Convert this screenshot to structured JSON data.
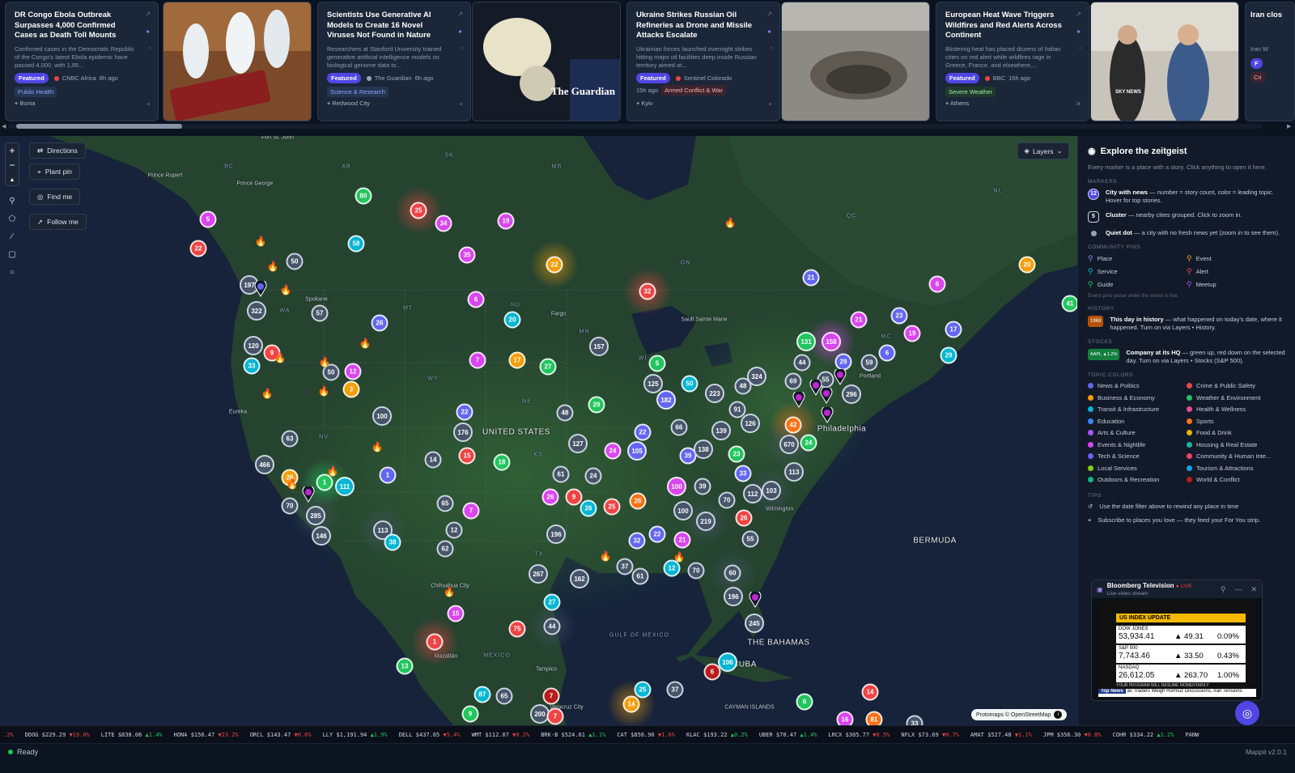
{
  "news": [
    {
      "title": "DR Congo Ebola Outbreak Surpasses 4,000 Confirmed Cases as Death Toll Mounts",
      "summary": "Confirmed cases in the Democratic Republic of the Congo's latest Ebola epidemic have passed 4,000, with 1,85...",
      "featured": "Featured",
      "source": "CNBC Africa",
      "time": "8h ago",
      "tag": "Public Health",
      "location": "Bunia"
    },
    {
      "title": "Scientists Use Generative AI Models to Create 16 Novel Viruses Not Found in Nature",
      "summary": "Researchers at Stanford University trained generative artificial intelligence models on biological genome data to...",
      "featured": "Featured",
      "source": "The Guardian",
      "time": "6h ago",
      "tag": "Science & Research",
      "location": "Redwood City"
    },
    {
      "title": "Ukraine Strikes Russian Oil Refineries as Drone and Missile Attacks Escalate",
      "summary": "Ukrainian forces launched overnight strikes hitting major oil facilities deep inside Russian territory aimed at...",
      "featured": "Featured",
      "source": "Sentinel Colorado",
      "time": "15h ago",
      "tag": "Armed Conflict & War",
      "location": "Kyiv"
    },
    {
      "title": "European Heat Wave Triggers Wildfires and Red Alerts Across Continent",
      "summary": "Blistering heat has placed dozens of Italian cities on red alert while wildfires rage in Greece, France, and elsewhere,...",
      "featured": "Featured",
      "source": "BBC",
      "time": "15h ago",
      "tag": "Severe Weather",
      "location": "Athens"
    }
  ],
  "partial_card": {
    "title": "Iran clos",
    "summary": "Iran W",
    "featured": "F",
    "tag": "Cri"
  },
  "image_labels": {
    "guardian": "The Guardian",
    "sky": "SKY NEWS"
  },
  "map": {
    "controls": {
      "zoom_in": "+",
      "zoom_out": "−",
      "compass": "▲",
      "directions": "Directions",
      "plant_pin": "Plant pin",
      "find_me": "Find me",
      "follow_me": "Follow me",
      "layers": "Layers"
    },
    "attribution": "Protomaps © OpenStreetMap",
    "labels": [
      {
        "t": "UNITED STATES",
        "k": "big"
      },
      {
        "t": "THE BAHAMAS",
        "k": "big"
      },
      {
        "t": "CUBA",
        "k": "big"
      },
      {
        "t": "BERMUDA",
        "k": "big"
      },
      {
        "t": "GULF OF MEXICO",
        "k": "st"
      },
      {
        "t": "CAYMAN ISLANDS",
        "k": "sm"
      },
      {
        "t": "Prince Rupert",
        "k": "sm"
      },
      {
        "t": "Prince George",
        "k": "sm"
      },
      {
        "t": "Fargo",
        "k": "sm"
      },
      {
        "t": "Sault Sainte Marie",
        "k": "sm"
      },
      {
        "t": "Spokane",
        "k": "sm"
      },
      {
        "t": "Eureka",
        "k": "sm"
      },
      {
        "t": "Wilmington",
        "k": "sm"
      },
      {
        "t": "Chihuahua City",
        "k": "sm"
      },
      {
        "t": "Mazatlán",
        "k": "sm"
      },
      {
        "t": "MEXICO",
        "k": "st"
      },
      {
        "t": "Tampico",
        "k": "sm"
      },
      {
        "t": "Veracruz City",
        "k": "sm"
      },
      {
        "t": "Philadelphia",
        "k": "big"
      },
      {
        "t": "Portland",
        "k": "sm"
      },
      {
        "t": "BC",
        "k": "st"
      },
      {
        "t": "AB",
        "k": "st"
      },
      {
        "t": "SK",
        "k": "st"
      },
      {
        "t": "MB",
        "k": "st"
      },
      {
        "t": "ON",
        "k": "st"
      },
      {
        "t": "QC",
        "k": "st"
      },
      {
        "t": "NL",
        "k": "st"
      },
      {
        "t": "WA",
        "k": "st"
      },
      {
        "t": "MT",
        "k": "st"
      },
      {
        "t": "ND",
        "k": "st"
      },
      {
        "t": "WY",
        "k": "st"
      },
      {
        "t": "NE",
        "k": "st"
      },
      {
        "t": "NV",
        "k": "st"
      },
      {
        "t": "KS",
        "k": "st"
      },
      {
        "t": "MN",
        "k": "st"
      },
      {
        "t": "WI",
        "k": "st"
      },
      {
        "t": "TX",
        "k": "st"
      },
      {
        "t": "MC",
        "k": "st"
      },
      {
        "t": "Fort St. John",
        "k": "sm"
      }
    ],
    "markers": [
      {
        "n": "80",
        "c": "#22c55e"
      },
      {
        "n": "25",
        "c": "#ef4444"
      },
      {
        "n": "34",
        "c": "#d946ef"
      },
      {
        "n": "19",
        "c": "#d946ef"
      },
      {
        "n": "5",
        "c": "#d946ef"
      },
      {
        "n": "22",
        "c": "#ef4444"
      },
      {
        "n": "58",
        "c": "#06b6d4"
      },
      {
        "n": "50",
        "c": "#475569"
      },
      {
        "n": "35",
        "c": "#d946ef"
      },
      {
        "n": "22",
        "c": "#f59e0b"
      },
      {
        "n": "20",
        "c": "#f59e0b"
      },
      {
        "n": "197",
        "c": "#475569"
      },
      {
        "n": "322",
        "c": "#475569"
      },
      {
        "n": "57",
        "c": "#475569"
      },
      {
        "n": "6",
        "c": "#d946ef"
      },
      {
        "n": "32",
        "c": "#ef4444"
      },
      {
        "n": "21",
        "c": "#6366f1"
      },
      {
        "n": "6",
        "c": "#d946ef"
      },
      {
        "n": "41",
        "c": "#22c55e"
      },
      {
        "n": "20",
        "c": "#06b6d4"
      },
      {
        "n": "26",
        "c": "#6366f1"
      },
      {
        "n": "120",
        "c": "#475569"
      },
      {
        "n": "9",
        "c": "#ef4444"
      },
      {
        "n": "33",
        "c": "#06b6d4"
      },
      {
        "n": "157",
        "c": "#475569"
      },
      {
        "n": "21",
        "c": "#d946ef"
      },
      {
        "n": "23",
        "c": "#6366f1"
      },
      {
        "n": "17",
        "c": "#6366f1"
      },
      {
        "n": "19",
        "c": "#d946ef"
      },
      {
        "n": "7",
        "c": "#d946ef"
      },
      {
        "n": "17",
        "c": "#f59e0b"
      },
      {
        "n": "27",
        "c": "#22c55e"
      },
      {
        "n": "50",
        "c": "#475569"
      },
      {
        "n": "12",
        "c": "#d946ef"
      },
      {
        "n": "3",
        "c": "#f59e0b"
      },
      {
        "n": "5",
        "c": "#22c55e"
      },
      {
        "n": "131",
        "c": "#22c55e"
      },
      {
        "n": "158",
        "c": "#d946ef"
      },
      {
        "n": "29",
        "c": "#6366f1"
      },
      {
        "n": "59",
        "c": "#475569"
      },
      {
        "n": "6",
        "c": "#6366f1"
      },
      {
        "n": "29",
        "c": "#06b6d4"
      },
      {
        "n": "125",
        "c": "#475569"
      },
      {
        "n": "50",
        "c": "#06b6d4"
      },
      {
        "n": "44",
        "c": "#475569"
      },
      {
        "n": "324",
        "c": "#475569"
      },
      {
        "n": "69",
        "c": "#475569"
      },
      {
        "n": "55",
        "c": "#475569"
      },
      {
        "n": "296",
        "c": "#475569"
      },
      {
        "n": "223",
        "c": "#475569"
      },
      {
        "n": "48",
        "c": "#475569"
      },
      {
        "n": "182",
        "c": "#6366f1"
      },
      {
        "n": "100",
        "c": "#475569"
      },
      {
        "n": "48",
        "c": "#475569"
      },
      {
        "n": "29",
        "c": "#22c55e"
      },
      {
        "n": "91",
        "c": "#475569"
      },
      {
        "n": "22",
        "c": "#6366f1"
      },
      {
        "n": "176",
        "c": "#475569"
      },
      {
        "n": "126",
        "c": "#475569"
      },
      {
        "n": "42",
        "c": "#f97316"
      },
      {
        "n": "670",
        "c": "#475569"
      },
      {
        "n": "24",
        "c": "#22c55e"
      },
      {
        "n": "63",
        "c": "#475569"
      },
      {
        "n": "127",
        "c": "#475569"
      },
      {
        "n": "24",
        "c": "#d946ef"
      },
      {
        "n": "105",
        "c": "#6366f1"
      },
      {
        "n": "66",
        "c": "#475569"
      },
      {
        "n": "139",
        "c": "#475569"
      },
      {
        "n": "22",
        "c": "#6366f1"
      },
      {
        "n": "14",
        "c": "#475569"
      },
      {
        "n": "15",
        "c": "#ef4444"
      },
      {
        "n": "18",
        "c": "#22c55e"
      },
      {
        "n": "39",
        "c": "#6366f1"
      },
      {
        "n": "138",
        "c": "#475569"
      },
      {
        "n": "23",
        "c": "#22c55e"
      },
      {
        "n": "113",
        "c": "#475569"
      },
      {
        "n": "466",
        "c": "#475569"
      },
      {
        "n": "26",
        "c": "#f59e0b"
      },
      {
        "n": "1",
        "c": "#22c55e"
      },
      {
        "n": "111",
        "c": "#06b6d4"
      },
      {
        "n": "1",
        "c": "#6366f1"
      },
      {
        "n": "61",
        "c": "#475569"
      },
      {
        "n": "24",
        "c": "#475569"
      },
      {
        "n": "33",
        "c": "#6366f1"
      },
      {
        "n": "103",
        "c": "#475569"
      },
      {
        "n": "70",
        "c": "#475569"
      },
      {
        "n": "285",
        "c": "#475569"
      },
      {
        "n": "65",
        "c": "#475569"
      },
      {
        "n": "7",
        "c": "#d946ef"
      },
      {
        "n": "26",
        "c": "#d946ef"
      },
      {
        "n": "9",
        "c": "#ef4444"
      },
      {
        "n": "26",
        "c": "#06b6d4"
      },
      {
        "n": "25",
        "c": "#ef4444"
      },
      {
        "n": "26",
        "c": "#f97316"
      },
      {
        "n": "100",
        "c": "#d946ef"
      },
      {
        "n": "39",
        "c": "#475569"
      },
      {
        "n": "70",
        "c": "#475569"
      },
      {
        "n": "112",
        "c": "#475569"
      },
      {
        "n": "146",
        "c": "#475569"
      },
      {
        "n": "113",
        "c": "#475569"
      },
      {
        "n": "38",
        "c": "#06b6d4"
      },
      {
        "n": "12",
        "c": "#475569"
      },
      {
        "n": "62",
        "c": "#475569"
      },
      {
        "n": "196",
        "c": "#475569"
      },
      {
        "n": "100",
        "c": "#475569"
      },
      {
        "n": "219",
        "c": "#475569"
      },
      {
        "n": "26",
        "c": "#ef4444"
      },
      {
        "n": "32",
        "c": "#6366f1"
      },
      {
        "n": "22",
        "c": "#6366f1"
      },
      {
        "n": "21",
        "c": "#d946ef"
      },
      {
        "n": "55",
        "c": "#475569"
      },
      {
        "n": "267",
        "c": "#475569"
      },
      {
        "n": "162",
        "c": "#475569"
      },
      {
        "n": "37",
        "c": "#475569"
      },
      {
        "n": "61",
        "c": "#475569"
      },
      {
        "n": "12",
        "c": "#06b6d4"
      },
      {
        "n": "70",
        "c": "#475569"
      },
      {
        "n": "60",
        "c": "#475569"
      },
      {
        "n": "196",
        "c": "#475569"
      },
      {
        "n": "245",
        "c": "#475569"
      },
      {
        "n": "27",
        "c": "#06b6d4"
      },
      {
        "n": "44",
        "c": "#475569"
      },
      {
        "n": "15",
        "c": "#d946ef"
      },
      {
        "n": "75",
        "c": "#ef4444"
      },
      {
        "n": "1",
        "c": "#ef4444"
      },
      {
        "n": "13",
        "c": "#22c55e"
      },
      {
        "n": "106",
        "c": "#06b6d4"
      },
      {
        "n": "6",
        "c": "#b91c1c"
      },
      {
        "n": "87",
        "c": "#06b6d4"
      },
      {
        "n": "65",
        "c": "#475569"
      },
      {
        "n": "7",
        "c": "#b91c1c"
      },
      {
        "n": "200",
        "c": "#475569"
      },
      {
        "n": "7",
        "c": "#ef4444"
      },
      {
        "n": "9",
        "c": "#22c55e"
      },
      {
        "n": "25",
        "c": "#06b6d4"
      },
      {
        "n": "37",
        "c": "#475569"
      },
      {
        "n": "14",
        "c": "#f59e0b"
      },
      {
        "n": "6",
        "c": "#22c55e"
      },
      {
        "n": "14",
        "c": "#ef4444"
      },
      {
        "n": "16",
        "c": "#d946ef"
      },
      {
        "n": "81",
        "c": "#f97316"
      },
      {
        "n": "33",
        "c": "#475569"
      }
    ]
  },
  "sidebar": {
    "title": "Explore the zeitgeist",
    "desc": "Every marker is a place with a story. Click anything to open it here.",
    "markers_head": "MARKERS",
    "m1_badge": "12",
    "m1_title": "City with news",
    "m1_text": " — number = story count, color = leading topic. Hover for top stories.",
    "m2_badge": "5",
    "m2_title": "Cluster",
    "m2_text": " — nearby cities grouped. Click to zoom in.",
    "m3_title": "Quiet dot",
    "m3_text": " — a city with no fresh news yet (zoom in to see them).",
    "pins_head": "COMMUNITY PINS",
    "pins": [
      {
        "l": "Place",
        "c": "#818cf8"
      },
      {
        "l": "Event",
        "c": "#f59e0b"
      },
      {
        "l": "Service",
        "c": "#06b6d4"
      },
      {
        "l": "Alert",
        "c": "#ef4444"
      },
      {
        "l": "Guide",
        "c": "#22c55e"
      },
      {
        "l": "Meetup",
        "c": "#a855f7"
      }
    ],
    "pins_note": "Event pins pulse while the event is live.",
    "history_head": "HISTORY",
    "history_badge": "1969",
    "history_title": "This day in history",
    "history_text": " — what happened on today's date, where it happened. Turn on via Layers • History.",
    "stocks_head": "STOCKS",
    "stocks_badge": "AAPL ▲1.2%",
    "stocks_title": "Company at its HQ",
    "stocks_text": " — green up, red down on the selected day. Turn on via Layers • Stocks (S&P 500).",
    "topics_head": "TOPIC COLORS",
    "topics": [
      {
        "l": "News & Politics",
        "c": "#6366f1"
      },
      {
        "l": "Crime & Public Safety",
        "c": "#ef4444"
      },
      {
        "l": "Business & Economy",
        "c": "#f59e0b"
      },
      {
        "l": "Weather & Environment",
        "c": "#22c55e"
      },
      {
        "l": "Transit & Infrastructure",
        "c": "#06b6d4"
      },
      {
        "l": "Health & Wellness",
        "c": "#ec4899"
      },
      {
        "l": "Education",
        "c": "#3b82f6"
      },
      {
        "l": "Sports",
        "c": "#f97316"
      },
      {
        "l": "Arts & Culture",
        "c": "#a855f7"
      },
      {
        "l": "Food & Drink",
        "c": "#eab308"
      },
      {
        "l": "Events & Nightlife",
        "c": "#d946ef"
      },
      {
        "l": "Housing & Real Estate",
        "c": "#14b8a6"
      },
      {
        "l": "Tech & Science",
        "c": "#6366f1"
      },
      {
        "l": "Community & Human Inte...",
        "c": "#f43f5e"
      },
      {
        "l": "Local Services",
        "c": "#84cc16"
      },
      {
        "l": "Tourism & Attractions",
        "c": "#0ea5e9"
      },
      {
        "l": "Outdoors & Recreation",
        "c": "#10b981"
      },
      {
        "l": "World & Conflict",
        "c": "#b91c1c"
      }
    ],
    "tips_head": "TIPS",
    "tip1": "Use the date filter above to rewind any place in time",
    "tip2": "Subscribe to places you love — they feed your For You strip."
  },
  "video": {
    "title": "Bloomberg Television",
    "live": "● LIVE",
    "sub": "Live video stream",
    "banner": "US INDEX UPDATE",
    "rows": [
      {
        "n": "DOW JONES",
        "v": "53,934.41",
        "ch": "▲ 49.31",
        "pc": "0.09%"
      },
      {
        "n": "S&P 500",
        "v": "7,743.46",
        "ch": "▲ 33.50",
        "pc": "0.43%"
      },
      {
        "n": "NASDAQ",
        "v": "26,612.05",
        "ch": "▲ 263.70",
        "pc": "1.00%"
      }
    ],
    "foot": "YOUR PROGRAM WILL RESUME MOMENTARILY",
    "ticker": "Top News",
    "ticker_text": "as Traders Weigh Hormuz Discussions, Iran Tensions"
  },
  "ticker": [
    {
      "t": "",
      "p": "",
      "c": ".2%",
      "d": "dn"
    },
    {
      "t": "DDOG",
      "p": "$229.29",
      "c": "▼19.0%",
      "d": "dn"
    },
    {
      "t": "LITE",
      "p": "$838.06",
      "c": "▲1.4%",
      "d": "up"
    },
    {
      "t": "HONA",
      "p": "$156.47",
      "c": "▼23.2%",
      "d": "dn"
    },
    {
      "t": "ORCL",
      "p": "$143.47",
      "c": "▼0.6%",
      "d": "dn"
    },
    {
      "t": "LLY",
      "p": "$1,191.94",
      "c": "▲1.9%",
      "d": "up"
    },
    {
      "t": "DELL",
      "p": "$437.65",
      "c": "▼5.4%",
      "d": "dn"
    },
    {
      "t": "WMT",
      "p": "$112.07",
      "c": "▼0.2%",
      "d": "dn"
    },
    {
      "t": "BRK-B",
      "p": "$524.61",
      "c": "▲1.1%",
      "d": "up"
    },
    {
      "t": "CAT",
      "p": "$856.96",
      "c": "▼1.6%",
      "d": "dn"
    },
    {
      "t": "KLAC",
      "p": "$193.22",
      "c": "▲0.2%",
      "d": "up"
    },
    {
      "t": "UBER",
      "p": "$70.47",
      "c": "▲1.4%",
      "d": "up"
    },
    {
      "t": "LRCX",
      "p": "$305.77",
      "c": "▼0.5%",
      "d": "dn"
    },
    {
      "t": "NFLX",
      "p": "$73.69",
      "c": "▼0.7%",
      "d": "dn"
    },
    {
      "t": "AMAT",
      "p": "$527.48",
      "c": "▼1.1%",
      "d": "dn"
    },
    {
      "t": "JPM",
      "p": "$356.30",
      "c": "▼0.8%",
      "d": "dn"
    },
    {
      "t": "COHR",
      "p": "$334.22",
      "c": "▲1.2%",
      "d": "up"
    },
    {
      "t": "PANW",
      "p": "",
      "c": "",
      "d": "up"
    }
  ],
  "status": {
    "ready": "Ready",
    "version": "Mappit v2.0.1"
  },
  "colors": {
    "accent": "#4f46e5",
    "bg": "#0d1524",
    "land": "#1f3a2c",
    "water": "#16233a"
  }
}
